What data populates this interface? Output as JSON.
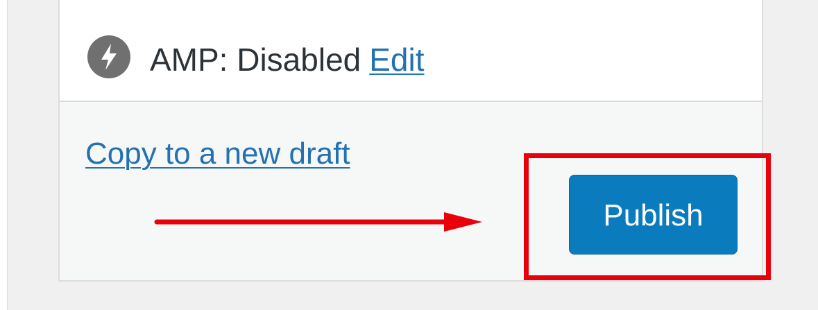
{
  "amp": {
    "status_label": "AMP: Disabled",
    "edit_label": "Edit",
    "icon": "lightning-bolt-icon"
  },
  "actions": {
    "copy_label": "Copy to a new draft",
    "publish_label": "Publish"
  },
  "annotation": {
    "highlight_color": "#e8000b",
    "arrow_color": "#e8000b"
  },
  "colors": {
    "link": "#2271b1",
    "primary_button": "#0a7bbd",
    "panel_footer": "#f6f7f7",
    "background": "#f0f0f1"
  }
}
